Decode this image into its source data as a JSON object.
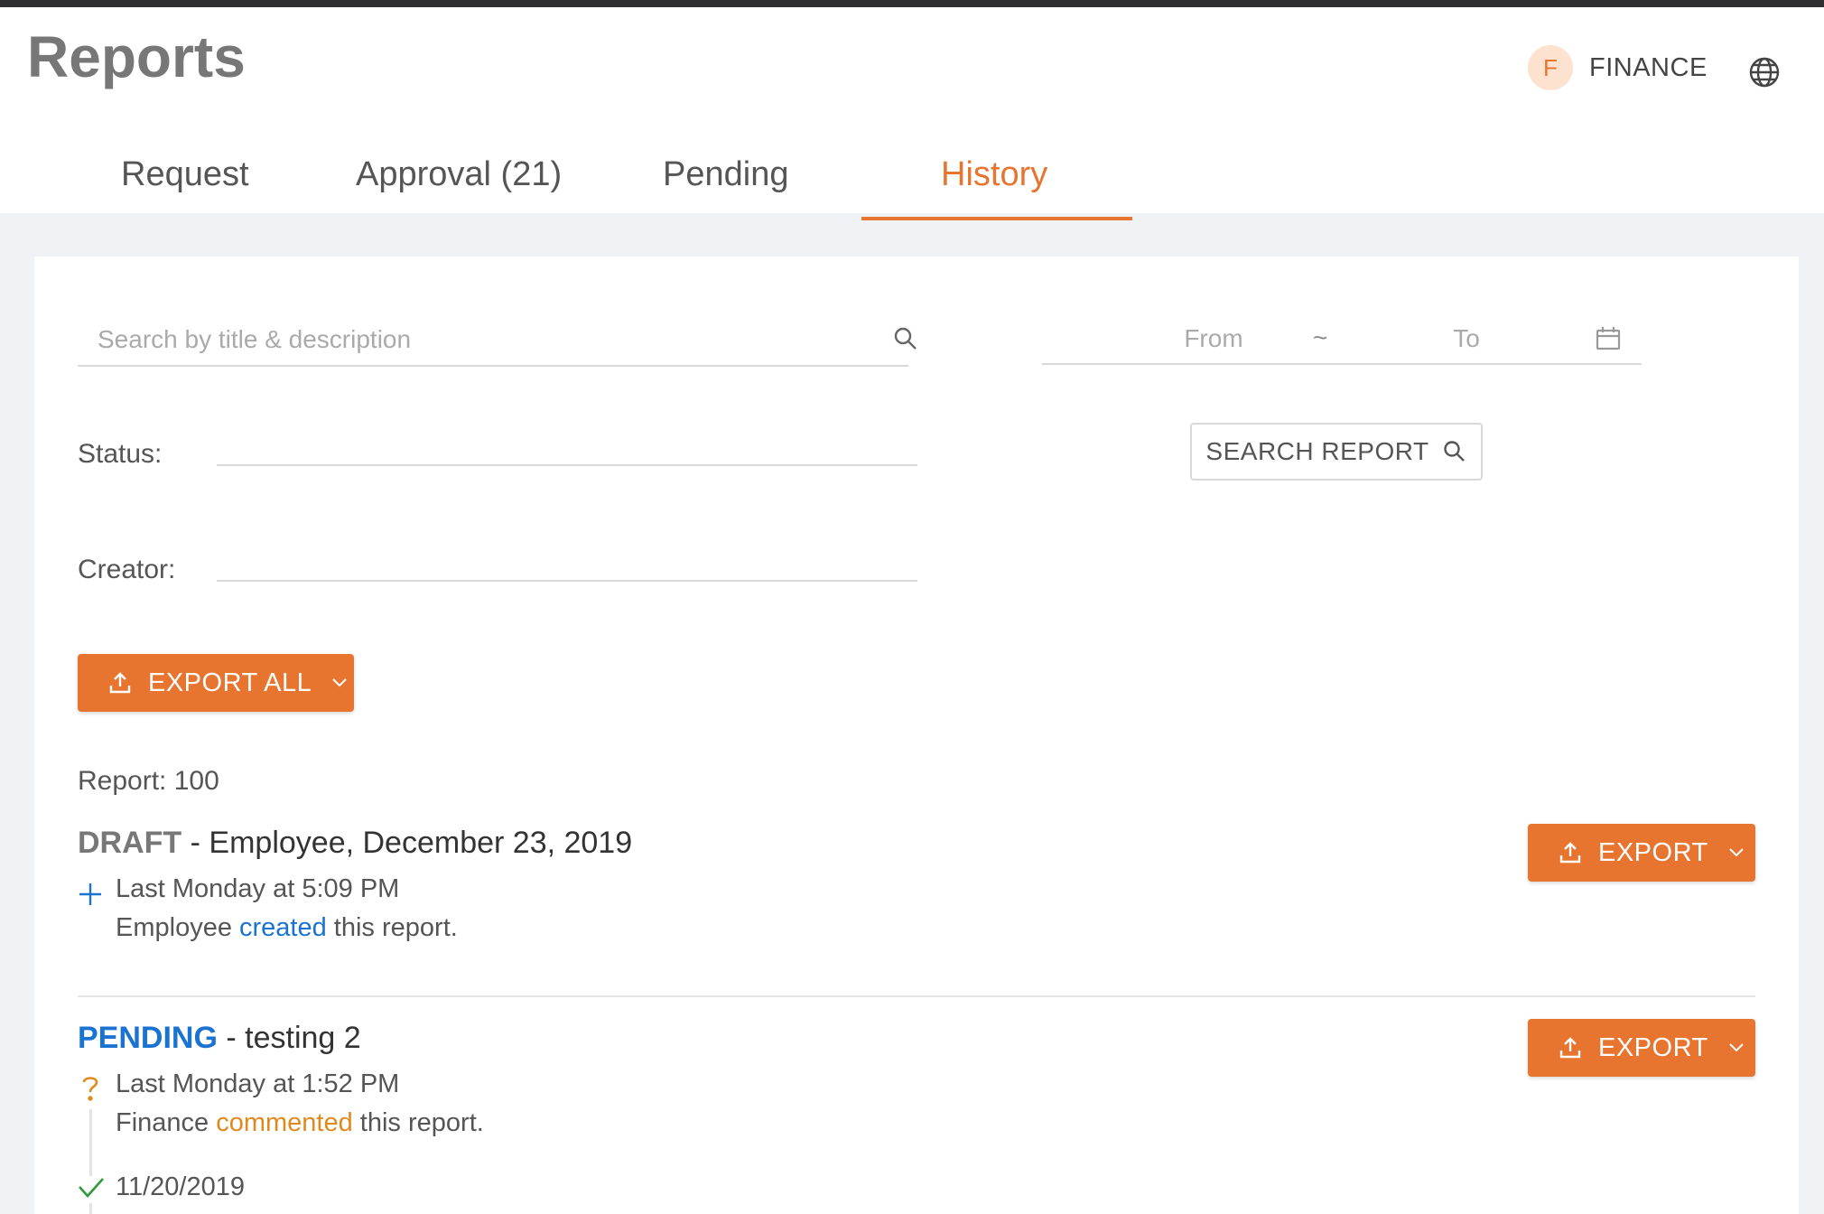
{
  "page": {
    "title": "Reports"
  },
  "user": {
    "avatar_initial": "F",
    "name": "FINANCE"
  },
  "tabs": [
    {
      "label": "Request",
      "active": false
    },
    {
      "label": "Approval (21)",
      "active": false
    },
    {
      "label": "Pending",
      "active": false
    },
    {
      "label": "History",
      "active": true
    }
  ],
  "filters": {
    "search_placeholder": "Search by title & description",
    "from_placeholder": "From",
    "date_separator": "~",
    "to_placeholder": "To",
    "status_label": "Status:",
    "creator_label": "Creator:",
    "search_button": "SEARCH REPORT"
  },
  "export_all_label": "EXPORT ALL",
  "report_count": "Report: 100",
  "reports": [
    {
      "status": "DRAFT",
      "title": " - Employee, December 23, 2019",
      "export_label": "EXPORT",
      "events": [
        {
          "icon": "plus-icon",
          "time": "Last Monday at 5:09 PM",
          "actor": "Employee ",
          "action": "created",
          "suffix": " this report."
        }
      ]
    },
    {
      "status": "PENDING",
      "title": " - testing 2",
      "export_label": "EXPORT",
      "events": [
        {
          "icon": "question-icon",
          "time": "Last Monday at 1:52 PM",
          "actor": "Finance ",
          "action": "commented",
          "suffix": " this report."
        },
        {
          "icon": "check-icon",
          "time": "11/20/2019"
        }
      ]
    }
  ],
  "colors": {
    "accent": "#e8752f",
    "link_blue": "#1a73d0",
    "comment_orange": "#e08a1e",
    "check_green": "#2e9b3a"
  }
}
